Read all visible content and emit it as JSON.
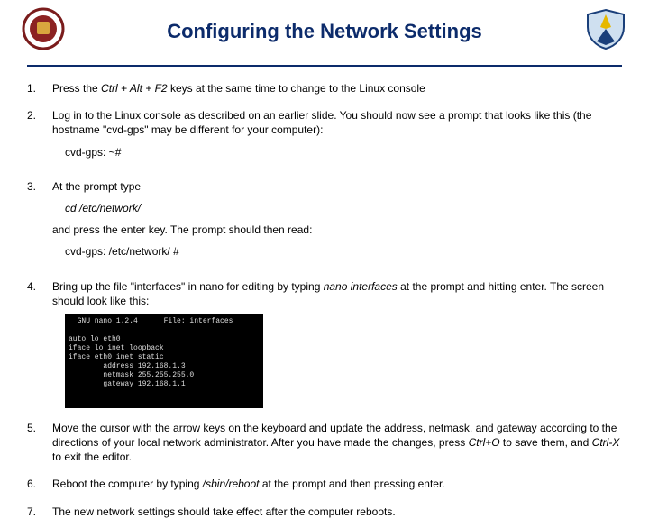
{
  "title": "Configuring the Network Settings",
  "items": [
    {
      "num": "1.",
      "pre": "Press the ",
      "cmd": "Ctrl + Alt + F2",
      "post": " keys at the same time to change to the Linux console"
    },
    {
      "num": "2.",
      "text": "Log in to the Linux console as described on an earlier slide. You should now see a prompt that looks like this (the hostname \"cvd-gps\" may be different for your computer):",
      "prompt1": "cvd-gps: ~#"
    },
    {
      "num": "3.",
      "text": "At the prompt type",
      "prompt2": "cd /etc/network/",
      "text2": "and press the enter key. The prompt should then read:",
      "prompt3": "cvd-gps: /etc/network/ #"
    },
    {
      "num": "4.",
      "pre": "Bring up the file \"interfaces\" in nano for editing by typing ",
      "cmd": "nano interfaces",
      "post": " at the prompt and hitting enter. The screen should look like this:",
      "terminal": "  GNU nano 1.2.4      File: interfaces\n\nauto lo eth0\niface lo inet loopback\niface eth0 inet static\n        address 192.168.1.3\n        netmask 255.255.255.0\n        gateway 192.168.1.1"
    },
    {
      "num": "5.",
      "pre": "Move the cursor with the arrow keys on the keyboard and update the address, netmask, and gateway according to the directions of your local network administrator. After you have made the changes, press ",
      "cmd": "Ctrl+O",
      "mid": " to save them, and ",
      "cmd2": "Ctrl-X",
      "post": " to exit the editor."
    },
    {
      "num": "6.",
      "pre": "Reboot the computer by typing ",
      "cmd": "/sbin/reboot",
      "post": " at the prompt and then pressing enter."
    },
    {
      "num": "7.",
      "text": "The new network settings should take effect after the computer reboots."
    }
  ]
}
